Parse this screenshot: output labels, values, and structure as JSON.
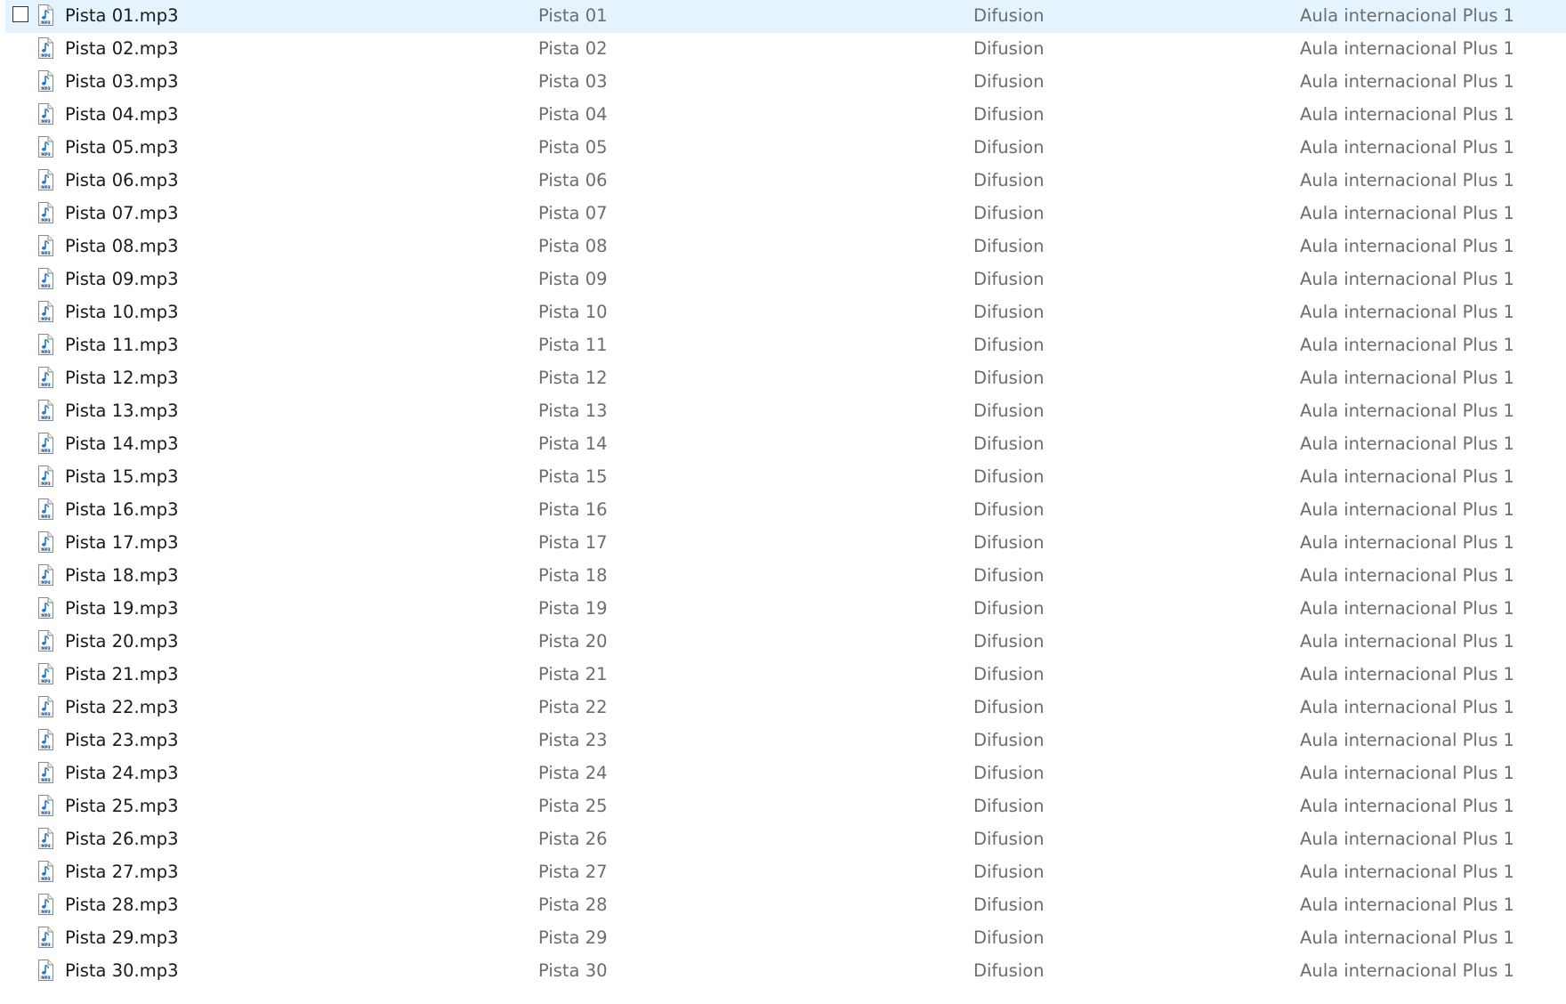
{
  "file_list": {
    "icon": "mp3-file-icon",
    "selected_index": 0,
    "rows": [
      {
        "name": "Pista 01.mp3",
        "title": "Pista 01",
        "artist": "Difusion",
        "album": "Aula internacional Plus 1"
      },
      {
        "name": "Pista 02.mp3",
        "title": "Pista 02",
        "artist": "Difusion",
        "album": "Aula internacional Plus 1"
      },
      {
        "name": "Pista 03.mp3",
        "title": "Pista 03",
        "artist": "Difusion",
        "album": "Aula internacional Plus 1"
      },
      {
        "name": "Pista 04.mp3",
        "title": "Pista 04",
        "artist": "Difusion",
        "album": "Aula internacional Plus 1"
      },
      {
        "name": "Pista 05.mp3",
        "title": "Pista 05",
        "artist": "Difusion",
        "album": "Aula internacional Plus 1"
      },
      {
        "name": "Pista 06.mp3",
        "title": "Pista 06",
        "artist": "Difusion",
        "album": "Aula internacional Plus 1"
      },
      {
        "name": "Pista 07.mp3",
        "title": "Pista 07",
        "artist": "Difusion",
        "album": "Aula internacional Plus 1"
      },
      {
        "name": "Pista 08.mp3",
        "title": "Pista 08",
        "artist": "Difusion",
        "album": "Aula internacional Plus 1"
      },
      {
        "name": "Pista 09.mp3",
        "title": "Pista 09",
        "artist": "Difusion",
        "album": "Aula internacional Plus 1"
      },
      {
        "name": "Pista 10.mp3",
        "title": "Pista 10",
        "artist": "Difusion",
        "album": "Aula internacional Plus 1"
      },
      {
        "name": "Pista 11.mp3",
        "title": "Pista 11",
        "artist": "Difusion",
        "album": "Aula internacional Plus 1"
      },
      {
        "name": "Pista 12.mp3",
        "title": "Pista 12",
        "artist": "Difusion",
        "album": "Aula internacional Plus 1"
      },
      {
        "name": "Pista 13.mp3",
        "title": "Pista 13",
        "artist": "Difusion",
        "album": "Aula internacional Plus 1"
      },
      {
        "name": "Pista 14.mp3",
        "title": "Pista 14",
        "artist": "Difusion",
        "album": "Aula internacional Plus 1"
      },
      {
        "name": "Pista 15.mp3",
        "title": "Pista 15",
        "artist": "Difusion",
        "album": "Aula internacional Plus 1"
      },
      {
        "name": "Pista 16.mp3",
        "title": "Pista 16",
        "artist": "Difusion",
        "album": "Aula internacional Plus 1"
      },
      {
        "name": "Pista 17.mp3",
        "title": "Pista 17",
        "artist": "Difusion",
        "album": "Aula internacional Plus 1"
      },
      {
        "name": "Pista 18.mp3",
        "title": "Pista 18",
        "artist": "Difusion",
        "album": "Aula internacional Plus 1"
      },
      {
        "name": "Pista 19.mp3",
        "title": "Pista 19",
        "artist": "Difusion",
        "album": "Aula internacional Plus 1"
      },
      {
        "name": "Pista 20.mp3",
        "title": "Pista 20",
        "artist": "Difusion",
        "album": "Aula internacional Plus 1"
      },
      {
        "name": "Pista 21.mp3",
        "title": "Pista 21",
        "artist": "Difusion",
        "album": "Aula internacional Plus 1"
      },
      {
        "name": "Pista 22.mp3",
        "title": "Pista 22",
        "artist": "Difusion",
        "album": "Aula internacional Plus 1"
      },
      {
        "name": "Pista 23.mp3",
        "title": "Pista 23",
        "artist": "Difusion",
        "album": "Aula internacional Plus 1"
      },
      {
        "name": "Pista 24.mp3",
        "title": "Pista 24",
        "artist": "Difusion",
        "album": "Aula internacional Plus 1"
      },
      {
        "name": "Pista 25.mp3",
        "title": "Pista 25",
        "artist": "Difusion",
        "album": "Aula internacional Plus 1"
      },
      {
        "name": "Pista 26.mp3",
        "title": "Pista 26",
        "artist": "Difusion",
        "album": "Aula internacional Plus 1"
      },
      {
        "name": "Pista 27.mp3",
        "title": "Pista 27",
        "artist": "Difusion",
        "album": "Aula internacional Plus 1"
      },
      {
        "name": "Pista 28.mp3",
        "title": "Pista 28",
        "artist": "Difusion",
        "album": "Aula internacional Plus 1"
      },
      {
        "name": "Pista 29.mp3",
        "title": "Pista 29",
        "artist": "Difusion",
        "album": "Aula internacional Plus 1"
      },
      {
        "name": "Pista 30.mp3",
        "title": "Pista 30",
        "artist": "Difusion",
        "album": "Aula internacional Plus 1"
      }
    ]
  }
}
